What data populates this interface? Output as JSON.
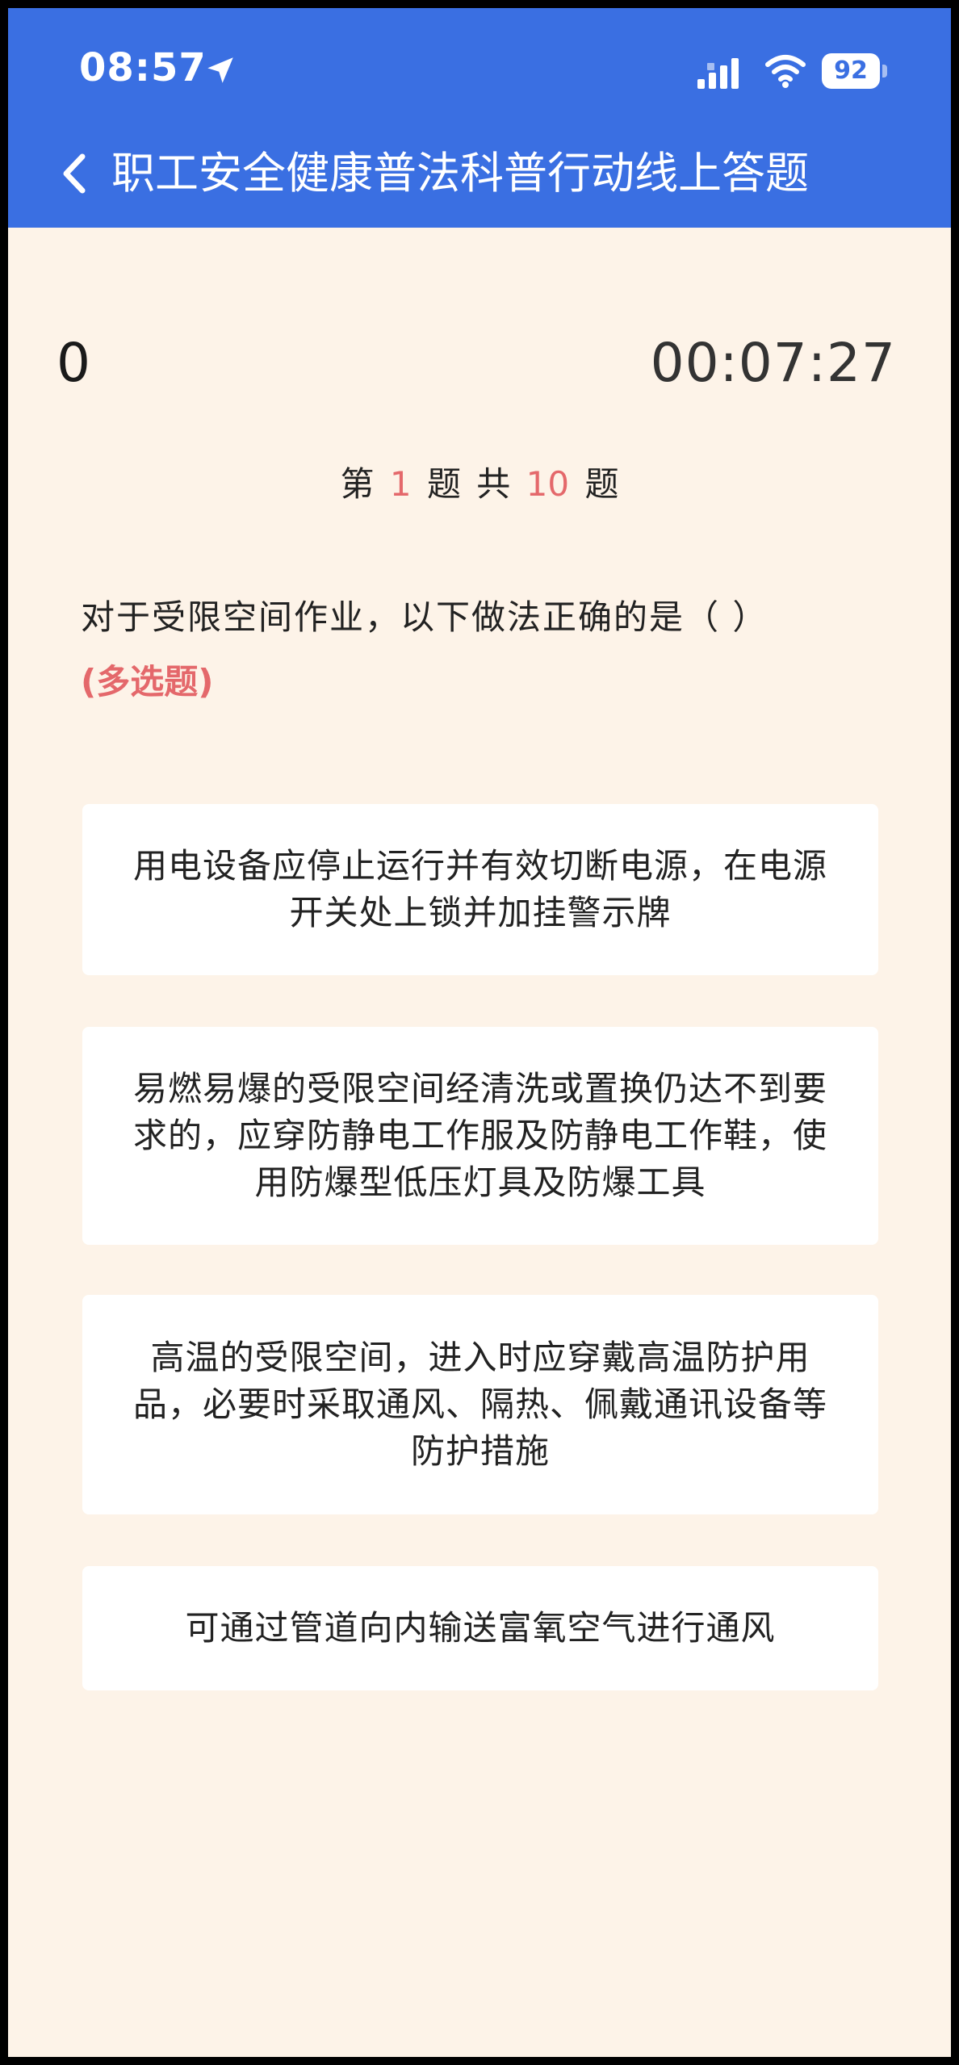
{
  "status_bar": {
    "time": "08:57",
    "battery": "92",
    "icons": [
      "location-arrow-icon",
      "signal-icon",
      "wifi-icon",
      "battery-icon"
    ]
  },
  "nav": {
    "title": "职工安全健康普法科普行动线上答题",
    "back_icon": "chevron-left-icon"
  },
  "quiz": {
    "score": "0",
    "timer": "00:07:27",
    "progress": {
      "prefix": "第",
      "current": "1",
      "middle": "题 共",
      "total": "10",
      "suffix": "题"
    },
    "question": "对于受限空间作业，以下做法正确的是（ ）",
    "question_type": "(多选题)",
    "options": [
      "用电设备应停止运行并有效切断电源，在电源开关处上锁并加挂警示牌",
      "易燃易爆的受限空间经清洗或置换仍达不到要求的，应穿防静电工作服及防静电工作鞋，使用防爆型低压灯具及防爆工具",
      "高温的受限空间，进入时应穿戴高温防护用品，必要时采取通风、隔热、佩戴通讯设备等防护措施",
      "可通过管道向内输送富氧空气进行通风"
    ]
  },
  "colors": {
    "header_blue": "#3a6fe2",
    "page_background": "#fdf3e8",
    "accent_red": "#e4686b",
    "option_background": "#ffffff"
  }
}
